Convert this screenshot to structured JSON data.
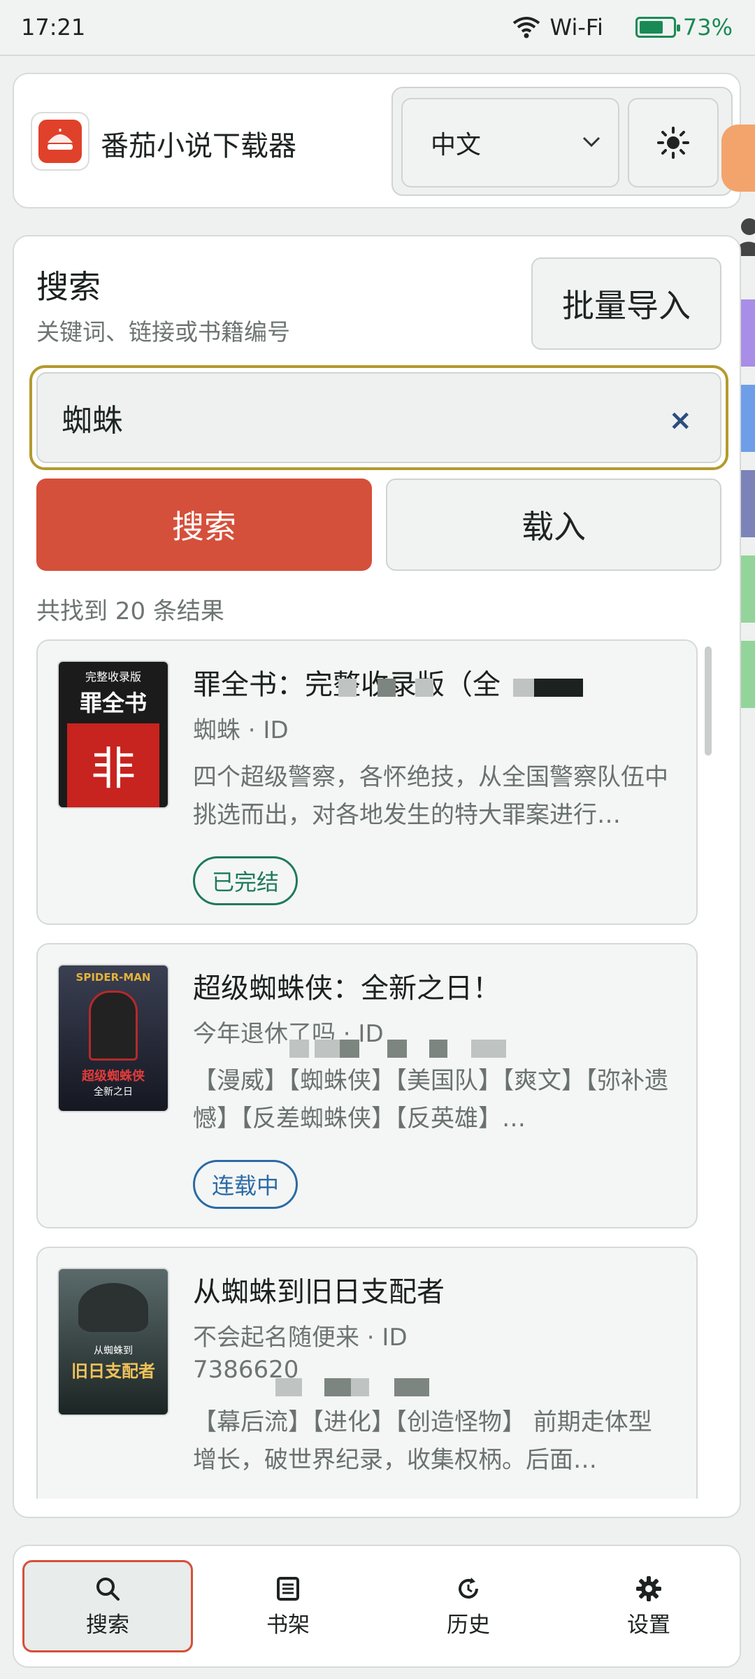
{
  "status_bar": {
    "time": "17:21",
    "wifi_label": "Wi-Fi",
    "battery": "73%",
    "battery_level": 0.73
  },
  "header": {
    "app_title": "番茄小说下载器",
    "language_value": "中文",
    "theme_icon": "sun-icon"
  },
  "search": {
    "title": "搜索",
    "subtitle": "关键词、链接或书籍编号",
    "batch_import_label": "批量导入",
    "query_value": "蜘蛛",
    "clear_label": "×",
    "search_button_label": "搜索",
    "load_button_label": "载入",
    "result_count": "共找到 20 条结果"
  },
  "results": [
    {
      "title": "罪全书：完整收录版（全",
      "meta": "蜘蛛 · ID",
      "description": "四个超级警察，各怀绝技，从全国警察队伍中挑选而出，对各地发生的特大罪案进行…",
      "status": "已完结",
      "cover_top": "完整收录版",
      "cover_main": "罪全书",
      "cover_glyph": "非"
    },
    {
      "title": "超级蜘蛛侠：全新之日！",
      "meta": "今年退休了吗 · ID",
      "description": "【漫威】【蜘蛛侠】【美国队】【爽文】【弥补遗憾】【反差蜘蛛侠】【反英雄】…",
      "status": "连载中",
      "cover_top": "SPIDER-MAN",
      "cover_main": "超级蜘蛛侠",
      "cover_sub": "全新之日"
    },
    {
      "title": "从蜘蛛到旧日支配者",
      "meta": "不会起名随便来 · ID",
      "meta_id": "7386620",
      "description": "【幕后流】【进化】【创造怪物】 前期走体型增长，破世界纪录，收集权柄。后面…",
      "cover_top": "从蜘蛛到",
      "cover_main": "旧日支配者"
    }
  ],
  "bottom_nav": [
    {
      "label": "搜索",
      "icon": "search-icon",
      "active": true
    },
    {
      "label": "书架",
      "icon": "bookshelf-icon",
      "active": false
    },
    {
      "label": "历史",
      "icon": "history-icon",
      "active": false
    },
    {
      "label": "设置",
      "icon": "gear-icon",
      "active": false
    }
  ],
  "colors": {
    "accent_red": "#d5503a",
    "completed_green": "#1f7a5a",
    "serializing_blue": "#2c6aa6",
    "focus_outline": "#b39a2e"
  }
}
